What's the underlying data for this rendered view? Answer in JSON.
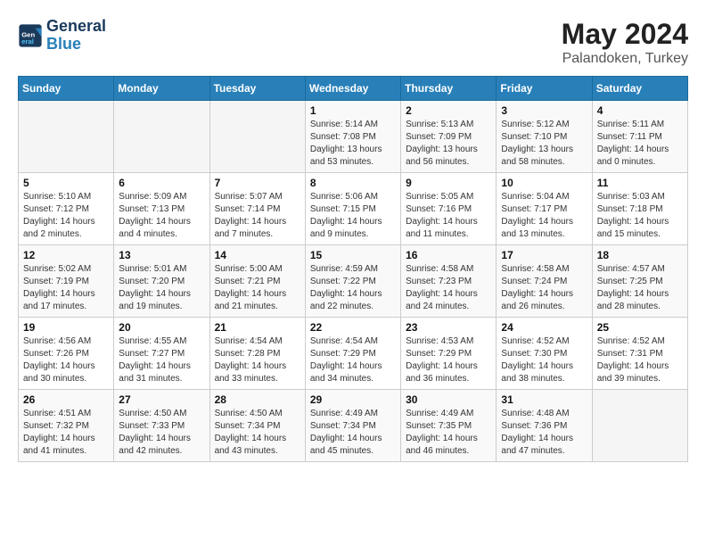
{
  "header": {
    "logo_general": "General",
    "logo_blue": "Blue",
    "month_year": "May 2024",
    "location": "Palandoken, Turkey"
  },
  "days_of_week": [
    "Sunday",
    "Monday",
    "Tuesday",
    "Wednesday",
    "Thursday",
    "Friday",
    "Saturday"
  ],
  "weeks": [
    [
      {
        "day": "",
        "sunrise": "",
        "sunset": "",
        "daylight": ""
      },
      {
        "day": "",
        "sunrise": "",
        "sunset": "",
        "daylight": ""
      },
      {
        "day": "",
        "sunrise": "",
        "sunset": "",
        "daylight": ""
      },
      {
        "day": "1",
        "sunrise": "Sunrise: 5:14 AM",
        "sunset": "Sunset: 7:08 PM",
        "daylight": "Daylight: 13 hours and 53 minutes."
      },
      {
        "day": "2",
        "sunrise": "Sunrise: 5:13 AM",
        "sunset": "Sunset: 7:09 PM",
        "daylight": "Daylight: 13 hours and 56 minutes."
      },
      {
        "day": "3",
        "sunrise": "Sunrise: 5:12 AM",
        "sunset": "Sunset: 7:10 PM",
        "daylight": "Daylight: 13 hours and 58 minutes."
      },
      {
        "day": "4",
        "sunrise": "Sunrise: 5:11 AM",
        "sunset": "Sunset: 7:11 PM",
        "daylight": "Daylight: 14 hours and 0 minutes."
      }
    ],
    [
      {
        "day": "5",
        "sunrise": "Sunrise: 5:10 AM",
        "sunset": "Sunset: 7:12 PM",
        "daylight": "Daylight: 14 hours and 2 minutes."
      },
      {
        "day": "6",
        "sunrise": "Sunrise: 5:09 AM",
        "sunset": "Sunset: 7:13 PM",
        "daylight": "Daylight: 14 hours and 4 minutes."
      },
      {
        "day": "7",
        "sunrise": "Sunrise: 5:07 AM",
        "sunset": "Sunset: 7:14 PM",
        "daylight": "Daylight: 14 hours and 7 minutes."
      },
      {
        "day": "8",
        "sunrise": "Sunrise: 5:06 AM",
        "sunset": "Sunset: 7:15 PM",
        "daylight": "Daylight: 14 hours and 9 minutes."
      },
      {
        "day": "9",
        "sunrise": "Sunrise: 5:05 AM",
        "sunset": "Sunset: 7:16 PM",
        "daylight": "Daylight: 14 hours and 11 minutes."
      },
      {
        "day": "10",
        "sunrise": "Sunrise: 5:04 AM",
        "sunset": "Sunset: 7:17 PM",
        "daylight": "Daylight: 14 hours and 13 minutes."
      },
      {
        "day": "11",
        "sunrise": "Sunrise: 5:03 AM",
        "sunset": "Sunset: 7:18 PM",
        "daylight": "Daylight: 14 hours and 15 minutes."
      }
    ],
    [
      {
        "day": "12",
        "sunrise": "Sunrise: 5:02 AM",
        "sunset": "Sunset: 7:19 PM",
        "daylight": "Daylight: 14 hours and 17 minutes."
      },
      {
        "day": "13",
        "sunrise": "Sunrise: 5:01 AM",
        "sunset": "Sunset: 7:20 PM",
        "daylight": "Daylight: 14 hours and 19 minutes."
      },
      {
        "day": "14",
        "sunrise": "Sunrise: 5:00 AM",
        "sunset": "Sunset: 7:21 PM",
        "daylight": "Daylight: 14 hours and 21 minutes."
      },
      {
        "day": "15",
        "sunrise": "Sunrise: 4:59 AM",
        "sunset": "Sunset: 7:22 PM",
        "daylight": "Daylight: 14 hours and 22 minutes."
      },
      {
        "day": "16",
        "sunrise": "Sunrise: 4:58 AM",
        "sunset": "Sunset: 7:23 PM",
        "daylight": "Daylight: 14 hours and 24 minutes."
      },
      {
        "day": "17",
        "sunrise": "Sunrise: 4:58 AM",
        "sunset": "Sunset: 7:24 PM",
        "daylight": "Daylight: 14 hours and 26 minutes."
      },
      {
        "day": "18",
        "sunrise": "Sunrise: 4:57 AM",
        "sunset": "Sunset: 7:25 PM",
        "daylight": "Daylight: 14 hours and 28 minutes."
      }
    ],
    [
      {
        "day": "19",
        "sunrise": "Sunrise: 4:56 AM",
        "sunset": "Sunset: 7:26 PM",
        "daylight": "Daylight: 14 hours and 30 minutes."
      },
      {
        "day": "20",
        "sunrise": "Sunrise: 4:55 AM",
        "sunset": "Sunset: 7:27 PM",
        "daylight": "Daylight: 14 hours and 31 minutes."
      },
      {
        "day": "21",
        "sunrise": "Sunrise: 4:54 AM",
        "sunset": "Sunset: 7:28 PM",
        "daylight": "Daylight: 14 hours and 33 minutes."
      },
      {
        "day": "22",
        "sunrise": "Sunrise: 4:54 AM",
        "sunset": "Sunset: 7:29 PM",
        "daylight": "Daylight: 14 hours and 34 minutes."
      },
      {
        "day": "23",
        "sunrise": "Sunrise: 4:53 AM",
        "sunset": "Sunset: 7:29 PM",
        "daylight": "Daylight: 14 hours and 36 minutes."
      },
      {
        "day": "24",
        "sunrise": "Sunrise: 4:52 AM",
        "sunset": "Sunset: 7:30 PM",
        "daylight": "Daylight: 14 hours and 38 minutes."
      },
      {
        "day": "25",
        "sunrise": "Sunrise: 4:52 AM",
        "sunset": "Sunset: 7:31 PM",
        "daylight": "Daylight: 14 hours and 39 minutes."
      }
    ],
    [
      {
        "day": "26",
        "sunrise": "Sunrise: 4:51 AM",
        "sunset": "Sunset: 7:32 PM",
        "daylight": "Daylight: 14 hours and 41 minutes."
      },
      {
        "day": "27",
        "sunrise": "Sunrise: 4:50 AM",
        "sunset": "Sunset: 7:33 PM",
        "daylight": "Daylight: 14 hours and 42 minutes."
      },
      {
        "day": "28",
        "sunrise": "Sunrise: 4:50 AM",
        "sunset": "Sunset: 7:34 PM",
        "daylight": "Daylight: 14 hours and 43 minutes."
      },
      {
        "day": "29",
        "sunrise": "Sunrise: 4:49 AM",
        "sunset": "Sunset: 7:34 PM",
        "daylight": "Daylight: 14 hours and 45 minutes."
      },
      {
        "day": "30",
        "sunrise": "Sunrise: 4:49 AM",
        "sunset": "Sunset: 7:35 PM",
        "daylight": "Daylight: 14 hours and 46 minutes."
      },
      {
        "day": "31",
        "sunrise": "Sunrise: 4:48 AM",
        "sunset": "Sunset: 7:36 PM",
        "daylight": "Daylight: 14 hours and 47 minutes."
      },
      {
        "day": "",
        "sunrise": "",
        "sunset": "",
        "daylight": ""
      }
    ]
  ]
}
